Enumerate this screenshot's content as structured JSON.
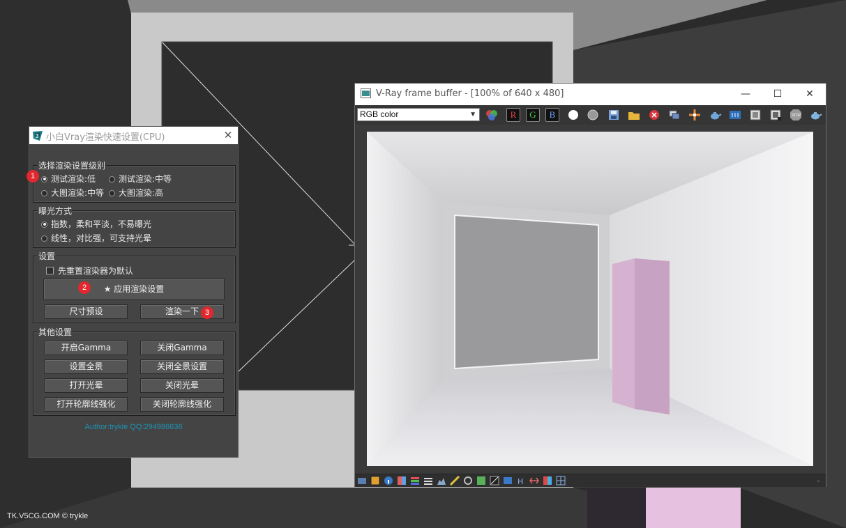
{
  "watermark": "TK.V5CG.COM © trykle",
  "dialog": {
    "title": "小白Vray渲染快速设置(CPU)",
    "close_glyph": "✕",
    "groups": {
      "level": {
        "label": "选择渲染设置级别",
        "options": [
          "测试渲染:低",
          "测试渲染:中等",
          "大图渲染:中等",
          "大图渲染:高"
        ],
        "selected": "测试渲染:低"
      },
      "exposure": {
        "label": "曝光方式",
        "options": [
          "指数，柔和平淡，不易曝光",
          "线性，对比强，可支持光晕"
        ],
        "selected": "指数，柔和平淡，不易曝光"
      },
      "settings": {
        "label": "设置",
        "reset_checkbox": "先重置渲染器为默认",
        "apply_button": "★ 应用渲染设置",
        "size_preset_button": "尺寸预设",
        "render_button": "渲染一下"
      },
      "other": {
        "label": "其他设置",
        "buttons": [
          [
            "开启Gamma",
            "关闭Gamma"
          ],
          [
            "设置全景",
            "关闭全景设置"
          ],
          [
            "打开光晕",
            "关闭光晕"
          ],
          [
            "打开轮廓线强化",
            "关闭轮廓线强化"
          ]
        ]
      }
    },
    "badges": [
      "1",
      "2",
      "3"
    ],
    "author": "Author:trykle QQ:294986636"
  },
  "vfb": {
    "title": "V-Ray frame buffer - [100% of 640 x 480]",
    "minimize_glyph": "—",
    "maximize_glyph": "☐",
    "close_glyph": "✕",
    "channel_select": "RGB color",
    "channel_buttons": [
      "R",
      "G",
      "B"
    ]
  },
  "colors": {
    "badge": "#e0282e",
    "author_text": "#1e94b4",
    "dialog_bg": "#444444",
    "vfb_bg": "#3a3a3a"
  }
}
